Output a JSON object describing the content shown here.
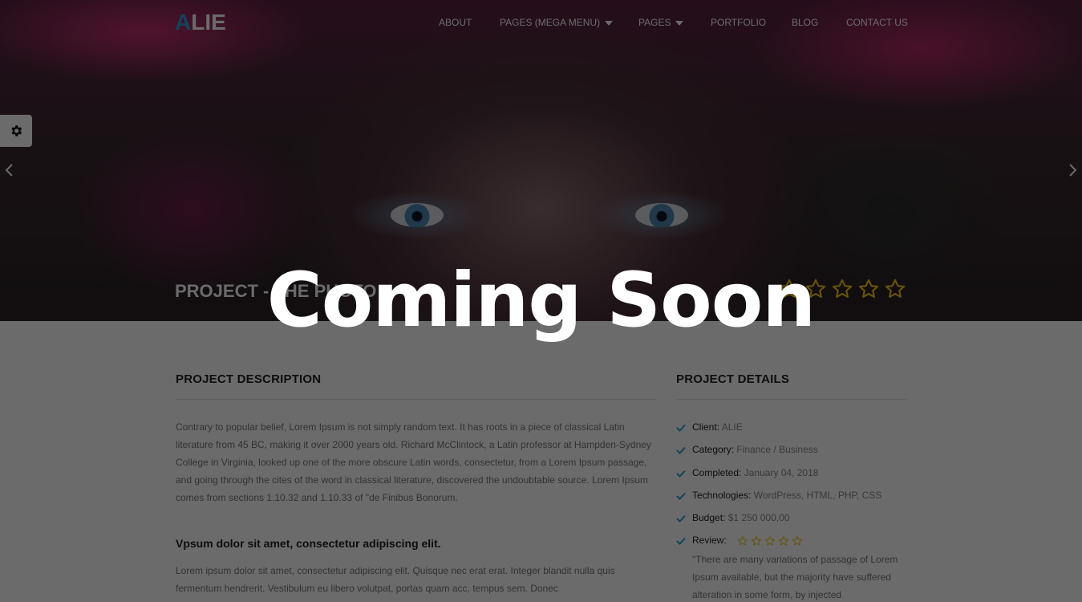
{
  "brand": {
    "first_letter": "A",
    "rest": "LIE",
    "accent_color": "#2a9fd8"
  },
  "nav": {
    "items": [
      {
        "label": "ABOUT",
        "dropdown": false
      },
      {
        "label": "PAGES (MEGA MENU)",
        "dropdown": true
      },
      {
        "label": "PAGES",
        "dropdown": true
      },
      {
        "label": "PORTFOLIO",
        "dropdown": false
      },
      {
        "label": "BLOG",
        "dropdown": false
      },
      {
        "label": "CONTACT US",
        "dropdown": false
      }
    ]
  },
  "icons": {
    "settings": "gear-icon",
    "prev": "chevron-left-icon",
    "next": "chevron-right-icon",
    "check": "check-icon",
    "star": "star-outline-icon"
  },
  "hero": {
    "title": "PROJECT - THE PHOTO",
    "rating_outline_stars": 5,
    "star_color": "#f5c518"
  },
  "description": {
    "heading": "PROJECT DESCRIPTION",
    "paragraph1": "Contrary to popular belief, Lorem Ipsum is not simply random text. It has roots in a piece of classical Latin literature from 45 BC, making it over 2000 years old. Richard McClintock, a Latin professor at Hampden-Sydney College in Virginia, looked up one of the more obscure Latin words, consectetur, from a Lorem Ipsum passage, and going through the cites of the word in classical literature, discovered the undoubtable source. Lorem Ipsum comes from sections 1.10.32 and 1.10.33 of \"de Finibus Bonorum.",
    "subheading": "Vpsum dolor sit amet, consectetur adipiscing elit.",
    "paragraph2": "Lorem ipsum dolor sit amet, consectetur adipiscing elit. Quisque nec erat erat. Integer blandit nulla quis fermentum hendrerit. Vestibulum eu libero volutpat, portas quam acc, tempus sem. Donec"
  },
  "details": {
    "heading": "PROJECT DETAILS",
    "rows": [
      {
        "key": "Client:",
        "value": "ALIE"
      },
      {
        "key": "Category:",
        "value": "Finance / Business"
      },
      {
        "key": "Completed:",
        "value": "January 04, 2018"
      },
      {
        "key": "Technologies:",
        "value": "WordPress, HTML, PHP, CSS"
      },
      {
        "key": "Budget:",
        "value": "$1 250 000,00"
      }
    ],
    "review_label": "Review:",
    "review_quote": "\"There are many variations of passage of Lorem Ipsum available, but the majority have suffered alteration in some form, by injected"
  },
  "overlay": {
    "text": "Coming Soon"
  }
}
